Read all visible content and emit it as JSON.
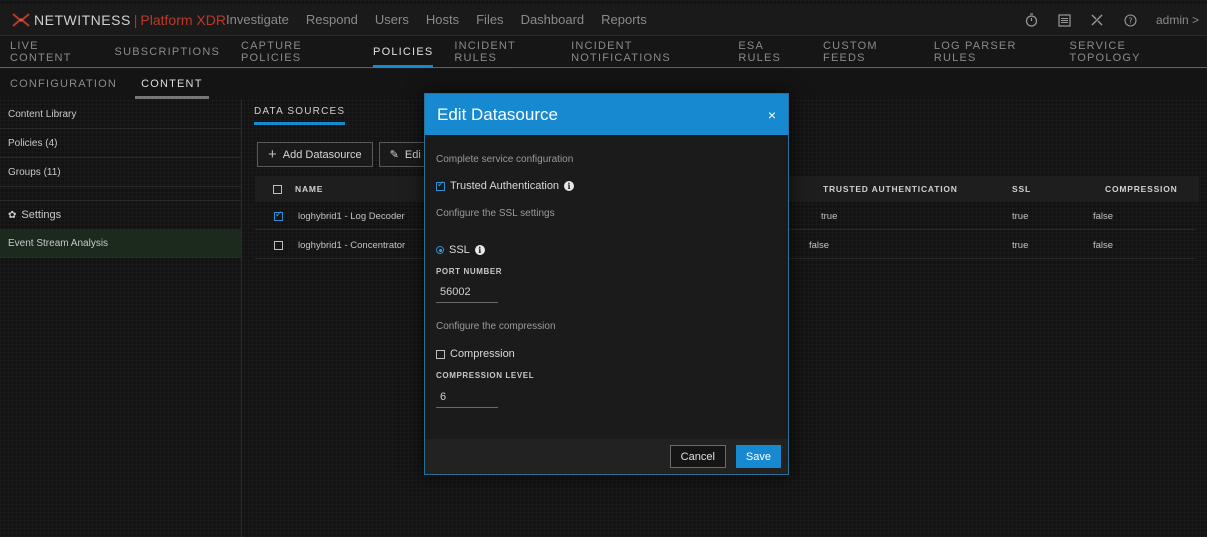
{
  "brand": {
    "name": "NETWITNESS",
    "separator": "|",
    "product": "Platform XDR"
  },
  "topnav": [
    "Investigate",
    "Respond",
    "Users",
    "Hosts",
    "Files",
    "Dashboard",
    "Reports"
  ],
  "topbar_right": {
    "user": "admin >"
  },
  "subnav": [
    "LIVE CONTENT",
    "SUBSCRIPTIONS",
    "CAPTURE POLICIES",
    "POLICIES",
    "INCIDENT RULES",
    "INCIDENT NOTIFICATIONS",
    "ESA RULES",
    "CUSTOM FEEDS",
    "LOG PARSER RULES",
    "SERVICE TOPOLOGY"
  ],
  "subnav_active": "POLICIES",
  "thirdnav": [
    "CONFIGURATION",
    "CONTENT"
  ],
  "thirdnav_active": "CONTENT",
  "sidebar": {
    "items": [
      "Content Library",
      "Policies (4)",
      "Groups (11)"
    ],
    "settings_label": "Settings",
    "selected_item": "Event Stream Analysis"
  },
  "main": {
    "tab": "DATA SOURCES",
    "add_button": "Add Datasource",
    "edit_button": "Edi",
    "columns": [
      "NAME",
      "TRUSTED AUTHENTICATION",
      "SSL",
      "COMPRESSION"
    ],
    "rows": [
      {
        "name": "loghybrid1 - Log Decoder",
        "trusted": "true",
        "ssl": "true",
        "compression": "false",
        "checked": true
      },
      {
        "name": "loghybrid1 - Concentrator",
        "trusted": "false",
        "ssl": "true",
        "compression": "false",
        "checked": false
      }
    ]
  },
  "modal": {
    "title": "Edit Datasource",
    "close": "×",
    "service_heading": "Complete service configuration",
    "trusted_label": "Trusted Authentication",
    "ssl_heading": "Configure the SSL settings",
    "ssl_label": "SSL",
    "port_label": "PORT NUMBER",
    "port_value": "56002",
    "compression_heading": "Configure the compression",
    "compression_label": "Compression",
    "compression_level_label": "COMPRESSION LEVEL",
    "compression_level_value": "6",
    "cancel": "Cancel",
    "save": "Save"
  },
  "colors": {
    "accent": "#1789d1",
    "brand_red": "#b83a2c"
  },
  "icons": [
    "netwitness-logo-icon",
    "timer-icon",
    "checklist-icon",
    "tools-icon",
    "help-icon",
    "gear-icon",
    "plus-icon",
    "pencil-icon",
    "info-icon",
    "close-icon"
  ]
}
